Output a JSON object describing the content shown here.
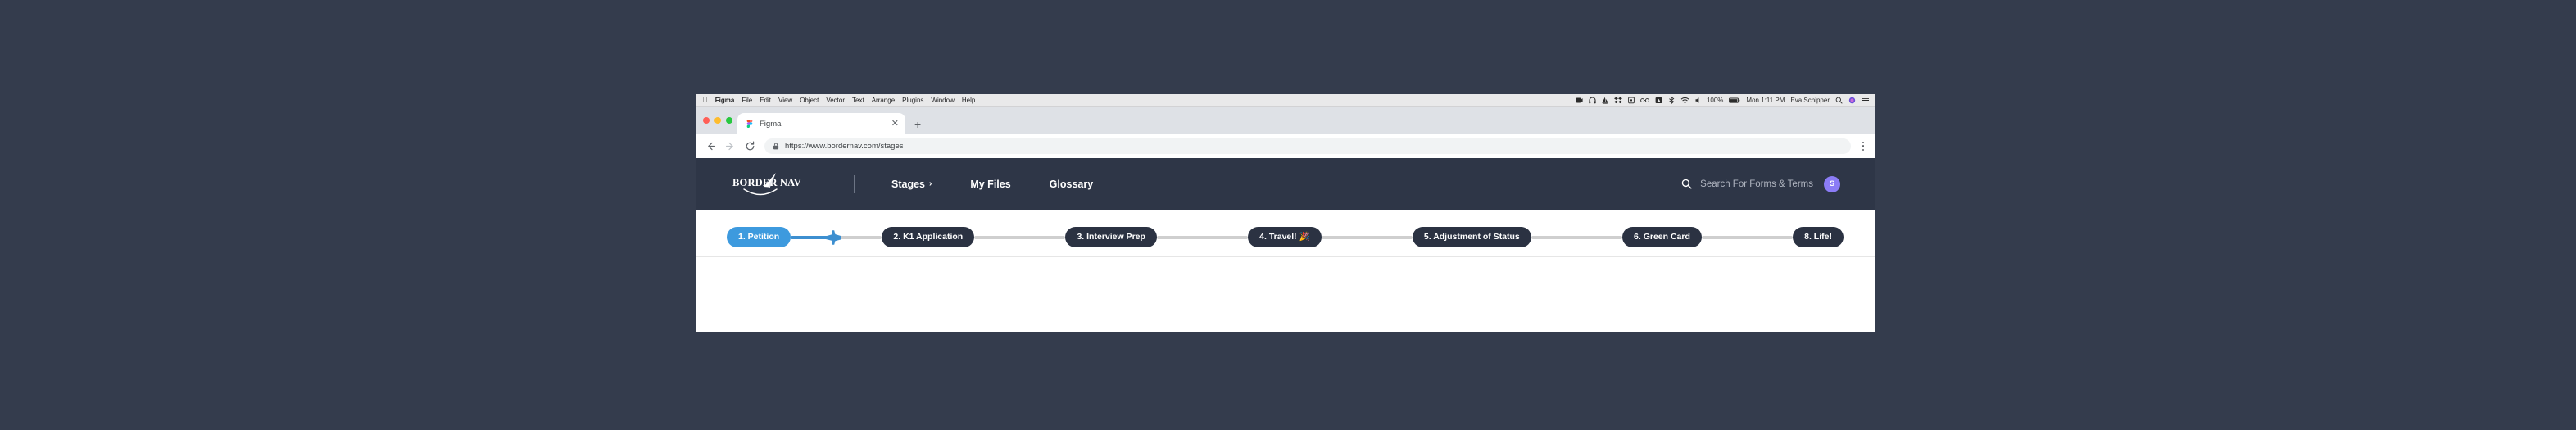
{
  "desktop": {
    "background": "#343c4d"
  },
  "menubar": {
    "apple_icon": "apple-icon",
    "items": [
      {
        "label": "Figma",
        "bold": true
      },
      {
        "label": "File"
      },
      {
        "label": "Edit"
      },
      {
        "label": "View"
      },
      {
        "label": "Object"
      },
      {
        "label": "Vector"
      },
      {
        "label": "Text"
      },
      {
        "label": "Arrange"
      },
      {
        "label": "Plugins"
      },
      {
        "label": "Window"
      },
      {
        "label": "Help"
      }
    ],
    "status": {
      "battery_percent": "100%",
      "clock": "Mon 1:11 PM",
      "user": "Eva Schipper",
      "icons": [
        "screen-recording-icon",
        "headphones-icon",
        "sailboat-icon",
        "dropbox-icon",
        "display-icon",
        "glasses-icon",
        "warning-triangle-icon",
        "bluetooth-icon",
        "wifi-icon",
        "volume-icon",
        "battery-icon",
        "search-icon",
        "siri-icon",
        "control-center-icon"
      ]
    }
  },
  "browser": {
    "traffic_lights": [
      "close-button",
      "minimize-button",
      "zoom-button"
    ],
    "tab": {
      "title": "Figma",
      "favicon": "figma-icon",
      "close_icon": "✕"
    },
    "new_tab_icon": "+",
    "back_icon": "←",
    "forward_icon": "→",
    "reload_icon": "⟳",
    "lock_icon": "lock-icon",
    "url": "https://www.bordernav.com/stages",
    "menu_icon": "kebab-menu-icon"
  },
  "site": {
    "background": "#2e3647",
    "logo": {
      "word1": "BORDER",
      "word2": "NAV",
      "mark": "paper-plane-icon"
    },
    "nav": [
      {
        "label": "Stages",
        "chevron": "›",
        "has_chevron": true
      },
      {
        "label": "My Files",
        "has_chevron": false
      },
      {
        "label": "Glossary",
        "has_chevron": false
      }
    ],
    "search": {
      "icon": "search-icon",
      "placeholder": "Search  For Forms & Terms"
    },
    "avatar": {
      "initial": "S",
      "color": "#8b7cf6"
    }
  },
  "stages": {
    "active_color": "#3d9ade",
    "inactive_color": "#2b3242",
    "connector_color": "#cfcfcf",
    "plane_icon": "airplane-icon",
    "items": [
      {
        "label": "1. Petition",
        "active": true
      },
      {
        "label": "2. K1 Application",
        "active": false
      },
      {
        "label": "3. Interview Prep",
        "active": false
      },
      {
        "label": "4. Travel! 🎉",
        "active": false
      },
      {
        "label": "5. Adjustment of Status",
        "active": false
      },
      {
        "label": "6. Green Card",
        "active": false
      },
      {
        "label": "8. Life!",
        "active": false
      }
    ]
  }
}
